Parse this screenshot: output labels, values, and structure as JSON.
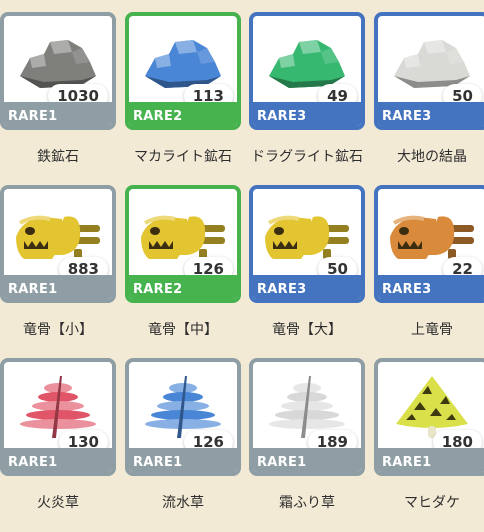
{
  "items": [
    {
      "name": "鉄鉱石",
      "rarity": "RARE1",
      "count": "1030",
      "icon": "iron-ore-icon",
      "color": "#7f7f7c"
    },
    {
      "name": "マカライト鉱石",
      "rarity": "RARE2",
      "count": "113",
      "icon": "machalite-ore-icon",
      "color": "#4a86d6"
    },
    {
      "name": "ドラグライト鉱石",
      "rarity": "RARE3",
      "count": "49",
      "icon": "dragonite-ore-icon",
      "color": "#37b871"
    },
    {
      "name": "大地の結晶",
      "rarity": "RARE3",
      "count": "50",
      "icon": "earth-crystal-icon",
      "color": "#d9d9d6"
    },
    {
      "name": "竜骨【小】",
      "rarity": "RARE1",
      "count": "883",
      "icon": "small-monster-bone-icon",
      "color": "#e3c532"
    },
    {
      "name": "竜骨【中】",
      "rarity": "RARE2",
      "count": "126",
      "icon": "medium-monster-bone-icon",
      "color": "#e3c532"
    },
    {
      "name": "竜骨【大】",
      "rarity": "RARE3",
      "count": "50",
      "icon": "large-monster-bone-icon",
      "color": "#e3c532"
    },
    {
      "name": "上竜骨",
      "rarity": "RARE3",
      "count": "22",
      "icon": "monster-bone-plus-icon",
      "color": "#d98a3a"
    },
    {
      "name": "火炎草",
      "rarity": "RARE1",
      "count": "130",
      "icon": "fire-herb-icon",
      "color": "#e05568"
    },
    {
      "name": "流水草",
      "rarity": "RARE1",
      "count": "126",
      "icon": "water-herb-icon",
      "color": "#4a86d6"
    },
    {
      "name": "霜ふり草",
      "rarity": "RARE1",
      "count": "189",
      "icon": "ice-herb-icon",
      "color": "#d8d8d8"
    },
    {
      "name": "マヒダケ",
      "rarity": "RARE1",
      "count": "180",
      "icon": "paralysis-mushroom-icon",
      "color": "#d9e04a"
    }
  ]
}
